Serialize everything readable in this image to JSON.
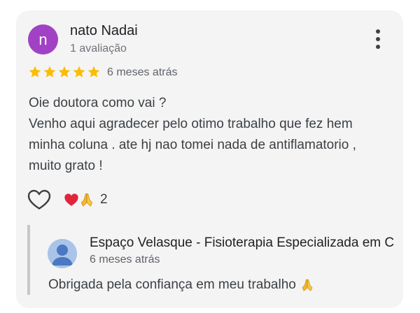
{
  "review": {
    "author": {
      "initial": "n",
      "name": "nato Nadai",
      "meta": "1 avaliação",
      "avatar_color": "#a142c4"
    },
    "rating": 5,
    "star_color": "#fbbc04",
    "date": "6 meses atrás",
    "text_lines": [
      "Oie doutora como vai ?",
      "Venho aqui agradecer pelo otimo trabalho que fez hem",
      "minha coluna . ate hj nao tomei nada de antiflamatorio ,",
      "muito grato !"
    ],
    "more_icon": "more-vert-icon",
    "like_icon": "heart-outline-icon",
    "reactions": {
      "icons": [
        "red-heart-icon",
        "folded-hands-icon"
      ],
      "count": "2"
    }
  },
  "owner_reply": {
    "name": "Espaço Velasque - Fisioterapia Especializada em C",
    "date": "6 meses atrás",
    "text": "Obrigada pela confiança em meu trabalho",
    "avatar_icon": "default-profile-icon",
    "text_icon": "folded-hands-icon"
  }
}
